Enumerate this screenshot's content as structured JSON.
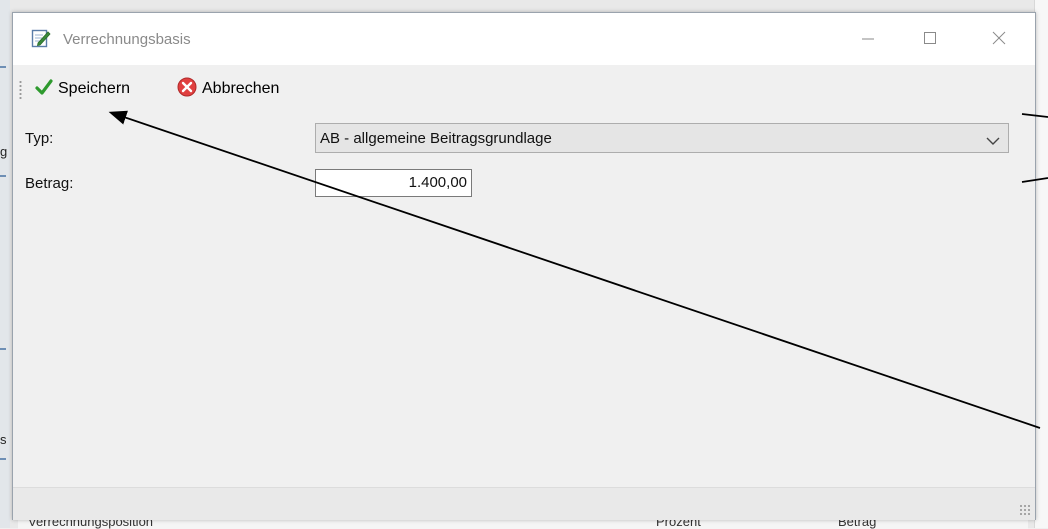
{
  "window": {
    "title": "Verrechnungsbasis",
    "controls": [
      "minimize-icon",
      "maximize-icon",
      "close-icon"
    ]
  },
  "toolbar": {
    "save_label": "Speichern",
    "cancel_label": "Abbrechen",
    "save_icon": "checkmark-icon",
    "cancel_icon": "cancel-x-icon",
    "colors": {
      "save_icon": "#2e9a2e",
      "cancel_icon": "#e04040"
    }
  },
  "form": {
    "type_label": "Typ:",
    "type_value": "AB - allgemeine Beitragsgrundlage",
    "amount_label": "Betrag:",
    "amount_value": "1.400,00"
  },
  "background": {
    "footer_columns": [
      "Verrechnungsposition",
      "Prozent",
      "Betrag"
    ],
    "left_letters": [
      "g",
      "s"
    ]
  },
  "annotation": {
    "arrow_color": "#000000"
  }
}
